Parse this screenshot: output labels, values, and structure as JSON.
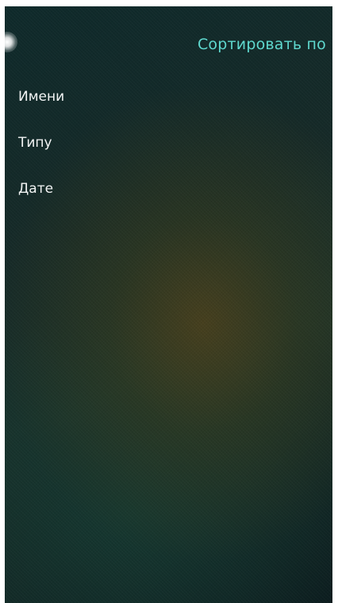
{
  "header": {
    "title": "Сортировать по"
  },
  "sort_options": [
    {
      "label": "Имени"
    },
    {
      "label": "Типу"
    },
    {
      "label": "Дате"
    }
  ],
  "colors": {
    "title": "#5fd9cf",
    "option_text": "#f2f4f4"
  }
}
